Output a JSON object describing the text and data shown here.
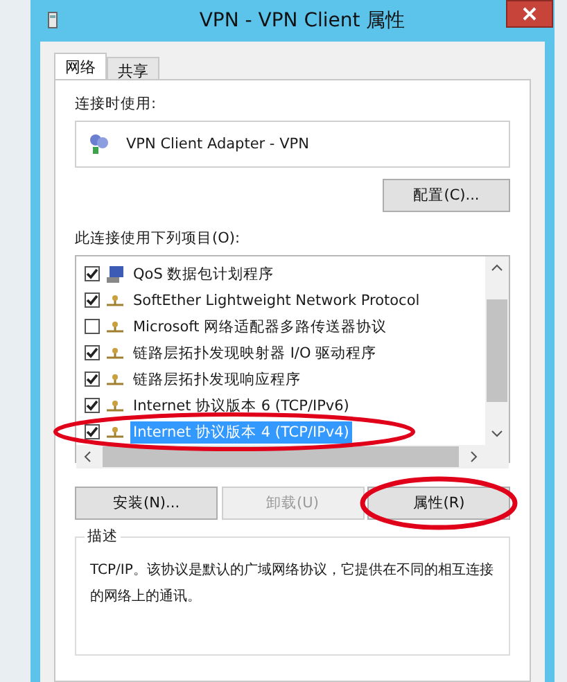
{
  "window": {
    "title": "VPN - VPN Client 属性"
  },
  "tabs": [
    {
      "label": "网络",
      "selected": true
    },
    {
      "label": "共享",
      "selected": false
    }
  ],
  "connect_using": {
    "label": "连接时使用:",
    "adapter": "VPN Client Adapter - VPN",
    "configure_button": "配置(C)..."
  },
  "items_label": "此连接使用下列项目(O):",
  "items": [
    {
      "label": "QoS 数据包计划程序",
      "checked": true,
      "selected": false,
      "kind": "service",
      "circled": false
    },
    {
      "label": "SoftEther Lightweight Network Protocol",
      "checked": true,
      "selected": false,
      "kind": "protocol",
      "circled": false
    },
    {
      "label": "Microsoft 网络适配器多路传送器协议",
      "checked": false,
      "selected": false,
      "kind": "protocol",
      "circled": false
    },
    {
      "label": "链路层拓扑发现映射器 I/O 驱动程序",
      "checked": true,
      "selected": false,
      "kind": "protocol",
      "circled": false
    },
    {
      "label": "链路层拓扑发现响应程序",
      "checked": true,
      "selected": false,
      "kind": "protocol",
      "circled": false
    },
    {
      "label": "Internet 协议版本 6 (TCP/IPv6)",
      "checked": true,
      "selected": false,
      "kind": "protocol",
      "circled": false
    },
    {
      "label": "Internet 协议版本 4 (TCP/IPv4)",
      "checked": true,
      "selected": true,
      "kind": "protocol",
      "circled": true
    }
  ],
  "buttons": [
    {
      "label": "安装(N)...",
      "disabled": false,
      "circled": false
    },
    {
      "label": "卸载(U)",
      "disabled": true,
      "circled": false
    },
    {
      "label": "属性(R)",
      "disabled": false,
      "circled": true
    }
  ],
  "description": {
    "label": "描述",
    "text": "TCP/IP。该协议是默认的广域网络协议，它提供在不同的相互连接的网络上的通讯。"
  }
}
